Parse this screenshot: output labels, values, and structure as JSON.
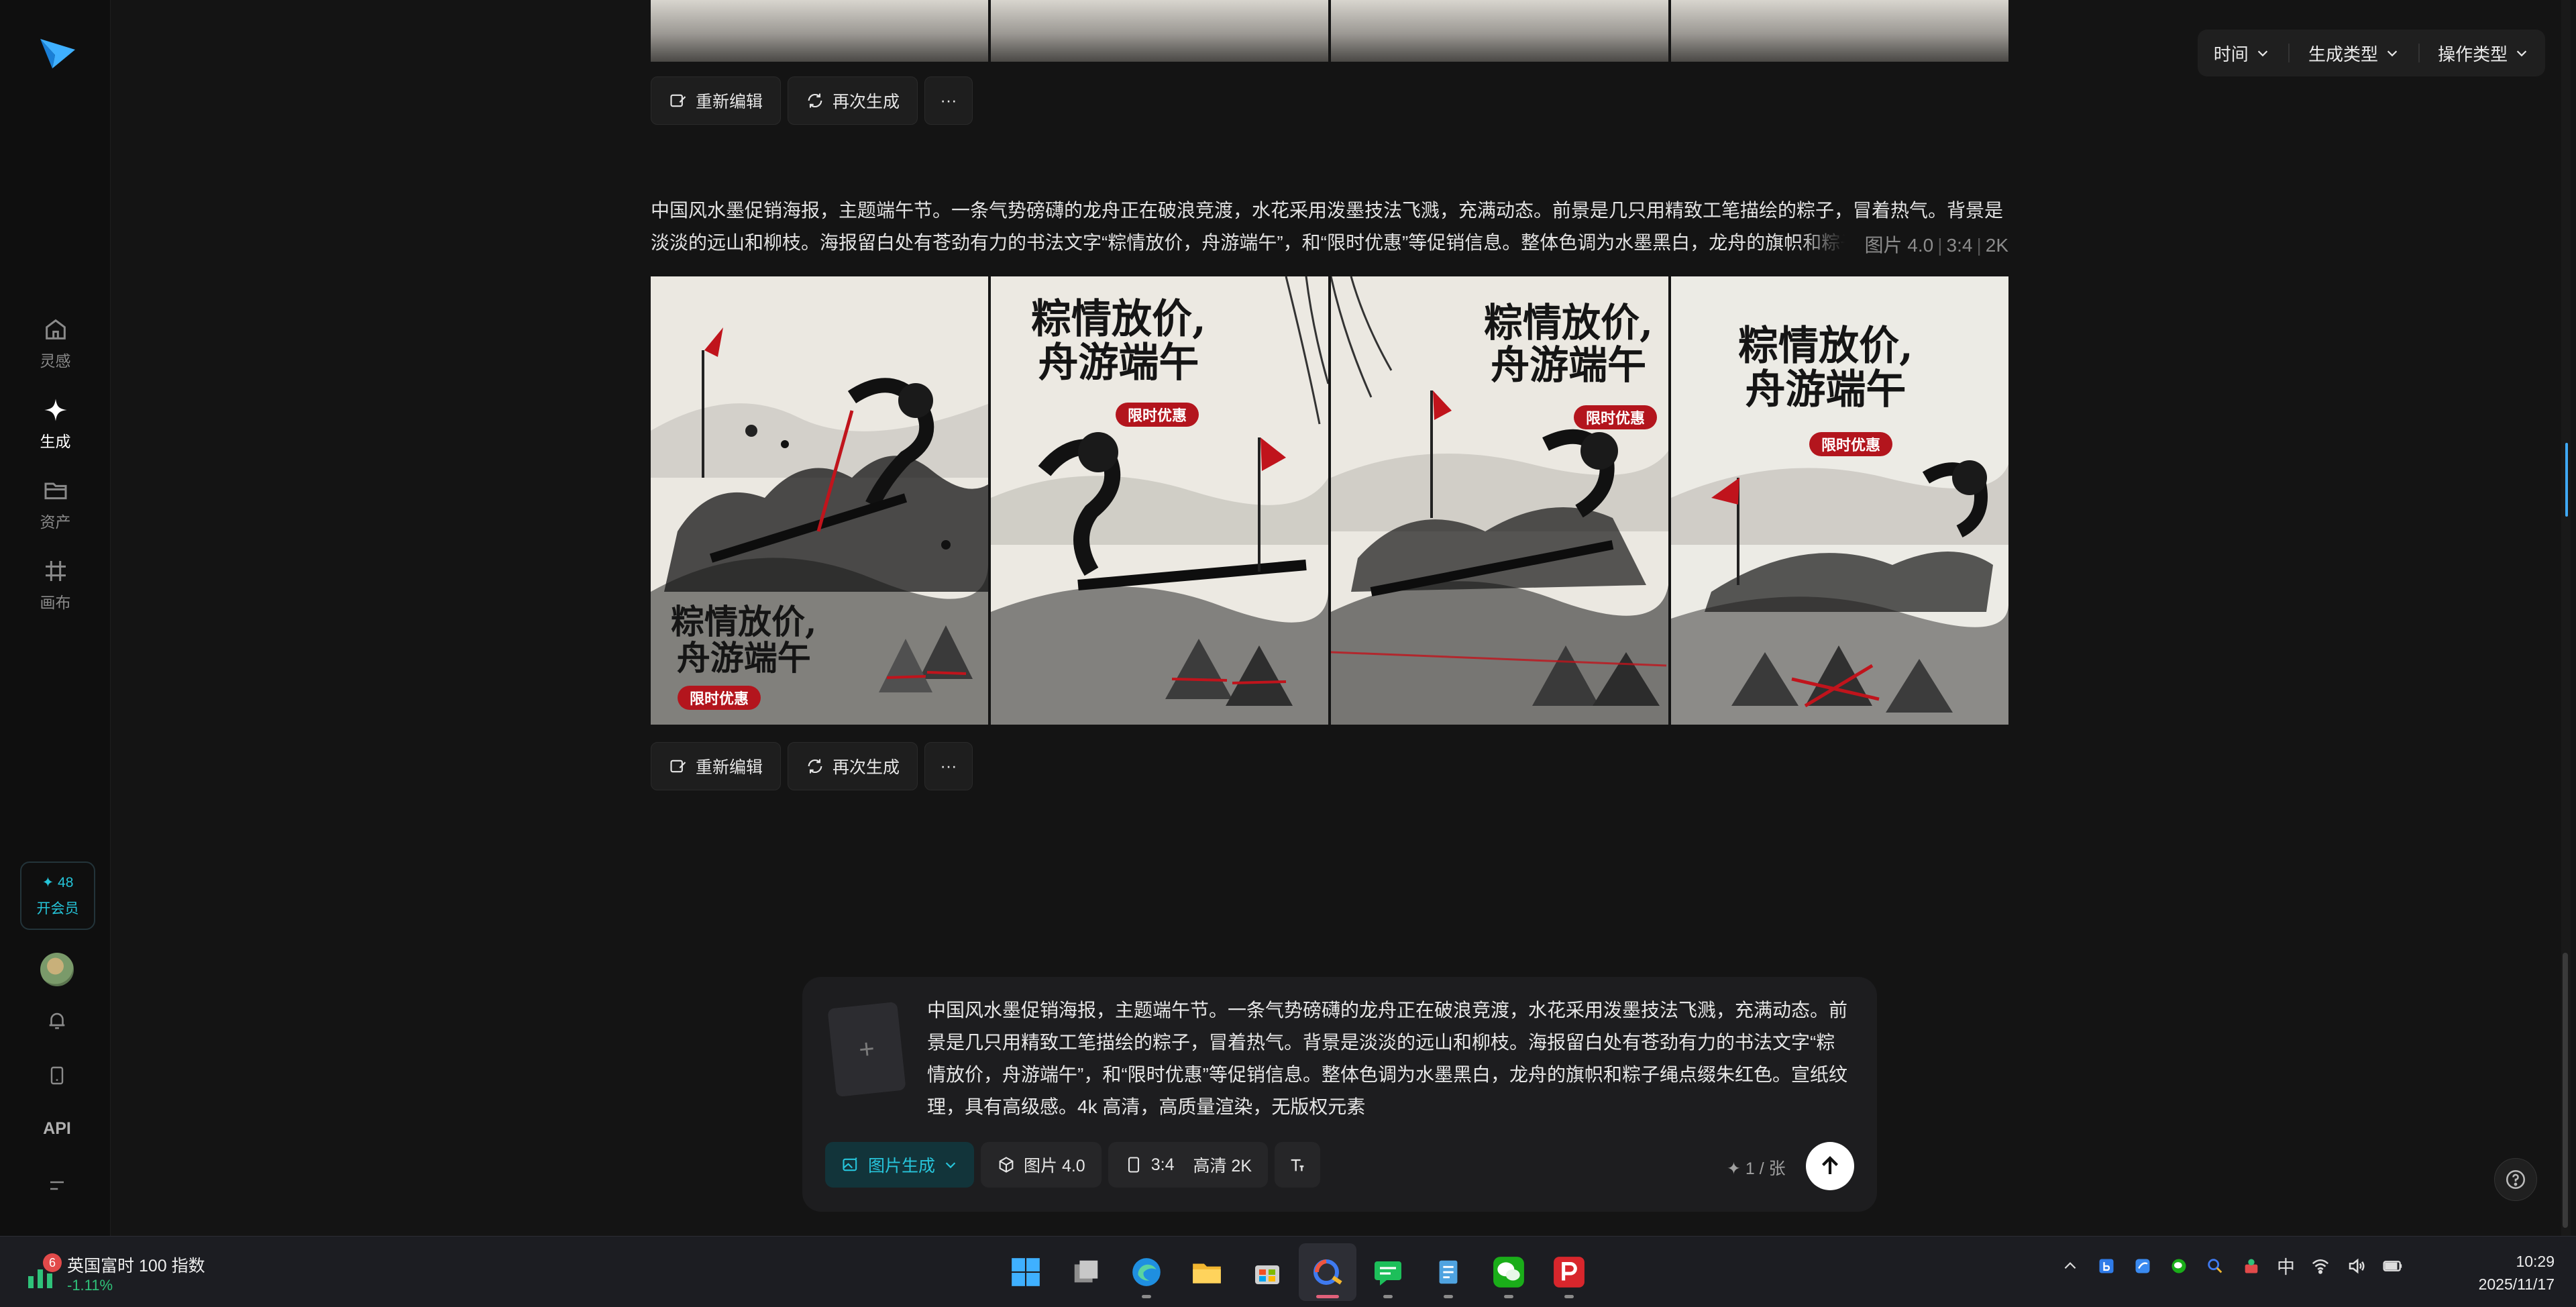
{
  "sidebar": {
    "items": [
      {
        "label": "灵感",
        "icon": "home-icon"
      },
      {
        "label": "生成",
        "icon": "sparkle-icon"
      },
      {
        "label": "资产",
        "icon": "folder-icon"
      },
      {
        "label": "画布",
        "icon": "canvas-icon"
      }
    ],
    "vip": {
      "points": "✦ 48",
      "label": "开会员"
    },
    "api_label": "API"
  },
  "filters": {
    "time": "时间",
    "gen_type": "生成类型",
    "op_type": "操作类型"
  },
  "actions": {
    "reedit": "重新编辑",
    "regenerate": "再次生成",
    "more": "···"
  },
  "record": {
    "prompt": "中国风水墨促销海报，主题端午节。一条气势磅礴的龙舟正在破浪竞渡，水花采用泼墨技法飞溅，充满动态。前景是几只用精致工笔描绘的粽子，冒着热气。背景是淡淡的远山和柳枝。海报留白处有苍劲有力的书法文字“粽情放价，舟游端午”，和“限时优惠”等促销信息。整体色调为水墨黑白，龙舟的旗帜和粽子绳点缀朱红色。",
    "model": "图片 4.0",
    "ratio": "3:4",
    "resolution": "2K"
  },
  "posters": [
    {
      "line1": "粽情放价,",
      "line2": "舟游端午",
      "badge": "限时优惠"
    },
    {
      "line1": "粽情放价,",
      "line2": "舟游端午",
      "badge": "限时优惠"
    },
    {
      "line1": "粽情放价,",
      "line2": "舟游端午",
      "badge": "限时优惠"
    },
    {
      "line1": "粽情放价,",
      "line2": "舟游端午",
      "badge": "限时优惠"
    }
  ],
  "composer": {
    "text": "中国风水墨促销海报，主题端午节。一条气势磅礴的龙舟正在破浪竞渡，水花采用泼墨技法飞溅，充满动态。前景是几只用精致工笔描绘的粽子，冒着热气。背景是淡淡的远山和柳枝。海报留白处有苍劲有力的书法文字“粽情放价，舟游端午”，和“限时优惠”等促销信息。整体色调为水墨黑白，龙舟的旗帜和粽子绳点缀朱红色。宣纸纹理，具有高级感。4k 高清，高质量渲染，无版权元素",
    "upload_plus": "+",
    "mode": "图片生成",
    "model": "图片 4.0",
    "ratio": "3:4",
    "quality": "高清 2K",
    "count": "✦ 1 / 张"
  },
  "taskbar": {
    "stock_name": "英国富时 100 指数",
    "stock_change": "-1.11%",
    "stock_badge": "6",
    "ime": "中",
    "time": "10:29",
    "date": "2025/11/17"
  },
  "colors": {
    "accent": "#27c5db",
    "stamp_red": "#b3151d",
    "bg": "#141414"
  }
}
